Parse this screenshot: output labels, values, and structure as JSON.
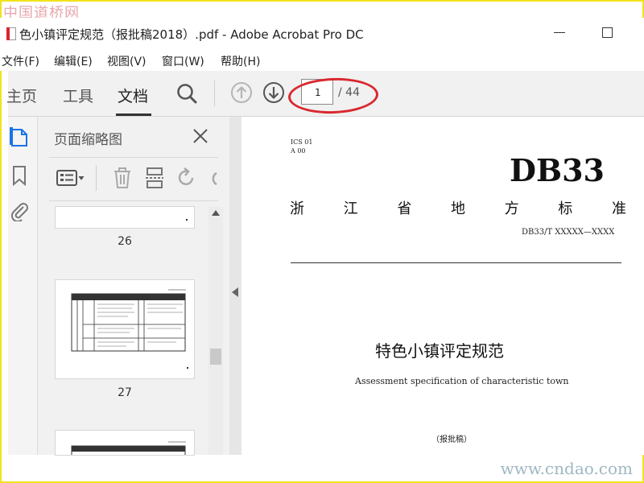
{
  "watermarks": {
    "top": "中国道桥网",
    "bottom": "www.cndao.com"
  },
  "window": {
    "title": "色小镇评定规范（报批稿2018）.pdf - Adobe Acrobat Pro DC"
  },
  "menu": [
    "文件(F)",
    "编辑(E)",
    "视图(V)",
    "窗口(W)",
    "帮助(H)"
  ],
  "toolbar": {
    "tabs": [
      "主页",
      "工具",
      "文档"
    ],
    "active_tab": "文档",
    "page_current": "1",
    "page_total": "/ 44"
  },
  "thumbnails": {
    "title": "页面缩略图",
    "pages": [
      {
        "label": "26"
      },
      {
        "label": "27"
      },
      {
        "label": ""
      }
    ]
  },
  "document": {
    "ics": "ICS  01",
    "ccs": "A 00",
    "standard_code": "DB33",
    "province_chars": [
      "浙",
      "江",
      "省",
      "地",
      "方",
      "标",
      "准"
    ],
    "doc_number": "DB33/T XXXXX—XXXX",
    "title_cn": "特色小镇评定规范",
    "title_en": "Assessment specification of characteristic town",
    "status": "（报批稿）"
  },
  "colors": {
    "highlight_ellipse": "#d9282e",
    "frame": "#f2e21a"
  }
}
